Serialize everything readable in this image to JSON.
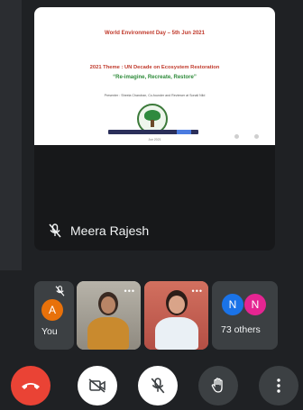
{
  "slide": {
    "title": "World Environment Day – 5th Jun 2021",
    "theme": "2021 Theme : UN Decade on Ecosystem Restoration",
    "tagline": "“Re-imagine, Recreate, Restore”",
    "presenter": "Presenter : Sheela Chandran, Co-founder and Reviewer at Sonali Nild",
    "footer": "Jun 2021"
  },
  "main": {
    "speaker_name": "Meera Rajesh"
  },
  "tiles": {
    "you": {
      "initial": "A",
      "label": "You"
    },
    "others": {
      "initial_1": "N",
      "initial_2": "N",
      "label": "73 others"
    }
  },
  "colors": {
    "leave": "#ea4335",
    "you_avatar": "#e8710a",
    "others_avatar_1": "#1a73e8",
    "others_avatar_2": "#e52592"
  },
  "controls": [
    "leave-call",
    "camera-off",
    "mic-off",
    "raise-hand",
    "more-options"
  ]
}
